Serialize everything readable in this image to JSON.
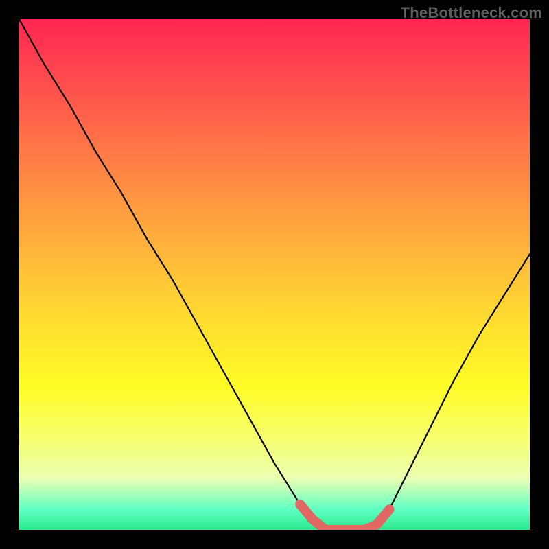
{
  "watermark": "TheBottleneck.com",
  "chart_data": {
    "type": "line",
    "x": [
      0.0,
      0.05,
      0.1,
      0.15,
      0.2,
      0.25,
      0.3,
      0.35,
      0.4,
      0.45,
      0.5,
      0.55,
      0.575,
      0.6,
      0.625,
      0.65,
      0.675,
      0.7,
      0.725,
      0.75,
      0.8,
      0.85,
      0.9,
      0.95,
      1.0
    ],
    "values": [
      100,
      91,
      83,
      74,
      66,
      57,
      49,
      40,
      31,
      22,
      13,
      5,
      2,
      0,
      0,
      0,
      0,
      1,
      4,
      9,
      19,
      29,
      38,
      46,
      54
    ],
    "title": "",
    "xlabel": "",
    "ylabel": "",
    "xlim": [
      0,
      1
    ],
    "ylim": [
      0,
      100
    ],
    "highlight_segment": {
      "x": [
        0.55,
        0.575,
        0.6,
        0.625,
        0.65,
        0.675,
        0.7,
        0.725
      ],
      "values": [
        5,
        2,
        0,
        0,
        0,
        0,
        1,
        4
      ],
      "color": "#e06762"
    },
    "background_gradient_colors": [
      "#ff2653",
      "#ff4c4e",
      "#ff7248",
      "#ff9941",
      "#ffbd39",
      "#ffdf2f",
      "#fffc26",
      "#f7ff6e",
      "#eaffb3",
      "#60ffc3",
      "#2bea8f"
    ]
  }
}
